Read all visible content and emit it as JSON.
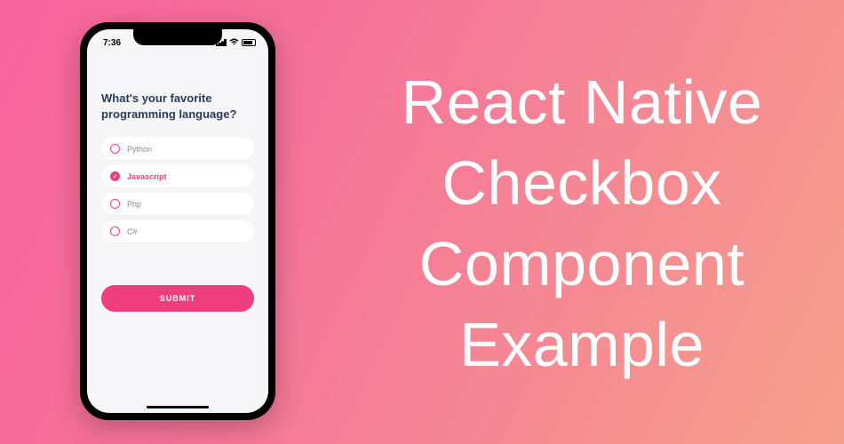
{
  "title_lines": [
    "React Native",
    "Checkbox",
    "Component",
    "Example"
  ],
  "statusbar": {
    "time": "7:36"
  },
  "question": "What's your favorite programming language?",
  "options": [
    {
      "label": "Python",
      "selected": false
    },
    {
      "label": "Javascript",
      "selected": true
    },
    {
      "label": "Php",
      "selected": false
    },
    {
      "label": "C#",
      "selected": false
    }
  ],
  "submit_label": "SUBMIT",
  "colors": {
    "accent": "#ef3e7e",
    "heading": "#2a3a5a"
  }
}
